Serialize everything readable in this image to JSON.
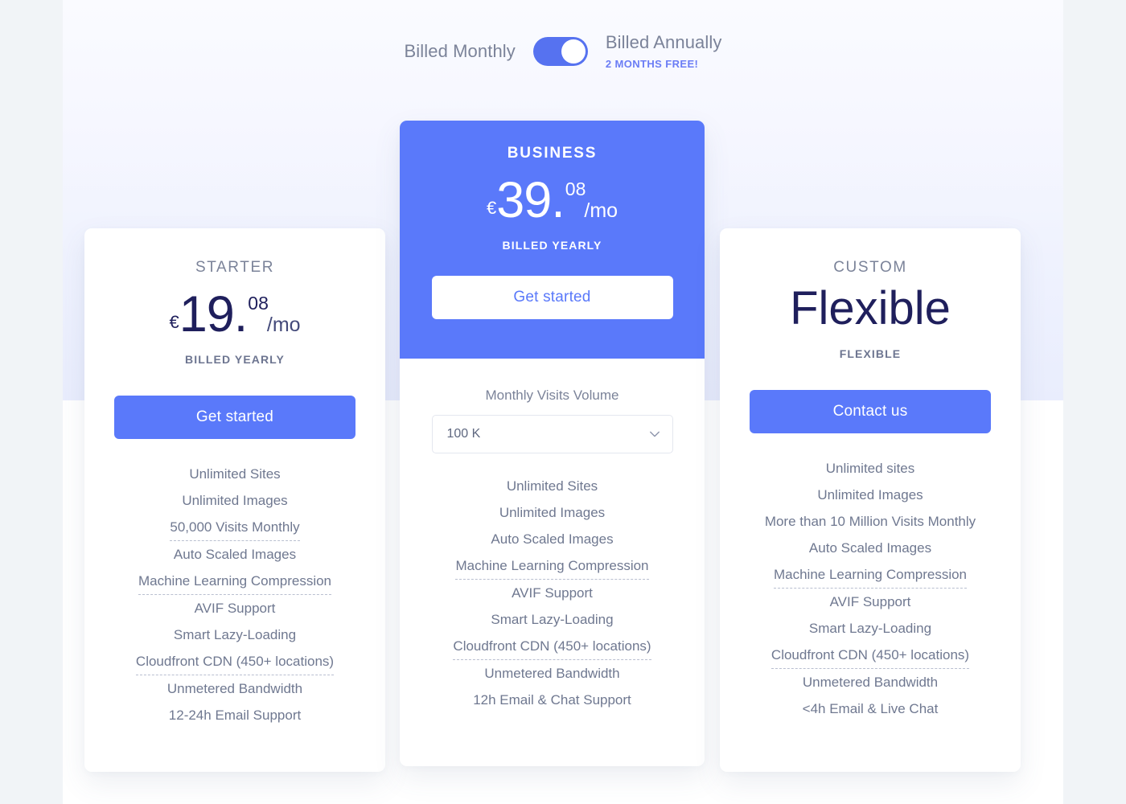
{
  "billing": {
    "monthly_label": "Billed Monthly",
    "annually_label": "Billed Annually",
    "promo_label": "2 MONTHS FREE!",
    "toggle_state": "annually",
    "accent_color": "#5672f0",
    "promo_color": "#6b7df5"
  },
  "plans": [
    {
      "id": "starter",
      "name": "STARTER",
      "currency": "€",
      "price_main": "19.",
      "price_cents": "08",
      "price_period": "/mo",
      "billed_note": "BILLED YEARLY",
      "cta_label": "Get started",
      "features": [
        {
          "label": "Unlimited Sites",
          "tooltip": false
        },
        {
          "label": "Unlimited Images",
          "tooltip": false
        },
        {
          "label": "50,000 Visits Monthly",
          "tooltip": true
        },
        {
          "label": "Auto Scaled Images",
          "tooltip": false
        },
        {
          "label": "Machine Learning Compression",
          "tooltip": true
        },
        {
          "label": "AVIF Support",
          "tooltip": false
        },
        {
          "label": "Smart Lazy-Loading",
          "tooltip": false
        },
        {
          "label": "Cloudfront CDN (450+ locations)",
          "tooltip": true
        },
        {
          "label": "Unmetered Bandwidth",
          "tooltip": false
        },
        {
          "label": "12-24h Email Support",
          "tooltip": false
        }
      ]
    },
    {
      "id": "business",
      "name": "BUSINESS",
      "currency": "€",
      "price_main": "39.",
      "price_cents": "08",
      "price_period": "/mo",
      "billed_note": "BILLED YEARLY",
      "cta_label": "Get started",
      "highlight_color": "#5a79fa",
      "visits_label": "Monthly Visits Volume",
      "visits_selected": "100 K",
      "visits_options": [
        "100 K"
      ],
      "chevron_icon": "chevron-down-icon",
      "features": [
        {
          "label": "Unlimited Sites",
          "tooltip": false
        },
        {
          "label": "Unlimited Images",
          "tooltip": false
        },
        {
          "label": "Auto Scaled Images",
          "tooltip": false
        },
        {
          "label": "Machine Learning Compression",
          "tooltip": true
        },
        {
          "label": "AVIF Support",
          "tooltip": false
        },
        {
          "label": "Smart Lazy-Loading",
          "tooltip": false
        },
        {
          "label": "Cloudfront CDN (450+ locations)",
          "tooltip": true
        },
        {
          "label": "Unmetered Bandwidth",
          "tooltip": false
        },
        {
          "label": "12h Email & Chat Support",
          "tooltip": false
        }
      ]
    },
    {
      "id": "custom",
      "name": "CUSTOM",
      "price_text": "Flexible",
      "billed_note": "FLEXIBLE",
      "cta_label": "Contact us",
      "features": [
        {
          "label": "Unlimited sites",
          "tooltip": false
        },
        {
          "label": "Unlimited Images",
          "tooltip": false
        },
        {
          "label": "More than 10 Million Visits Monthly",
          "tooltip": false
        },
        {
          "label": "Auto Scaled Images",
          "tooltip": false
        },
        {
          "label": "Machine Learning Compression",
          "tooltip": true
        },
        {
          "label": "AVIF Support",
          "tooltip": false
        },
        {
          "label": "Smart Lazy-Loading",
          "tooltip": false
        },
        {
          "label": "Cloudfront CDN (450+ locations)",
          "tooltip": true
        },
        {
          "label": "Unmetered Bandwidth",
          "tooltip": false
        },
        {
          "label": "<4h Email & Live Chat",
          "tooltip": false
        }
      ]
    }
  ]
}
